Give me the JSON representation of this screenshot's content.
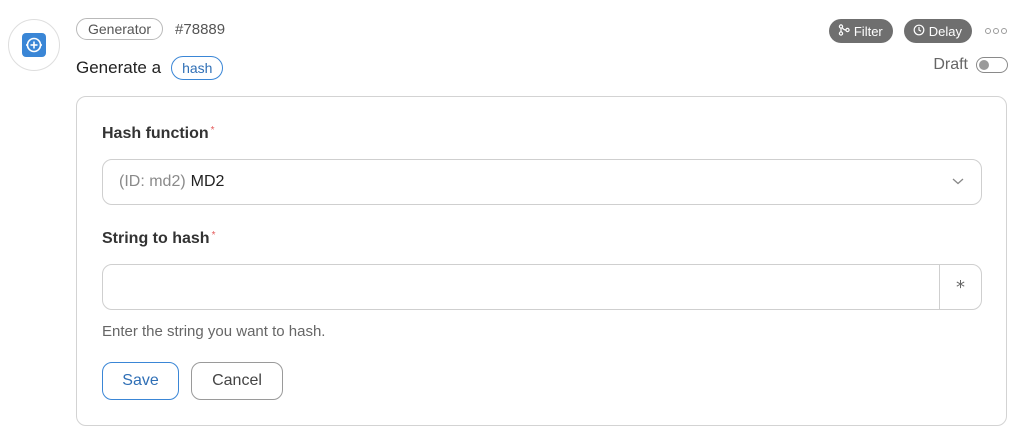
{
  "header": {
    "app_pill": "Generator",
    "step_id": "#78889",
    "title_prefix": "Generate a",
    "action_pill": "hash"
  },
  "controls": {
    "filter_label": "Filter",
    "delay_label": "Delay",
    "draft_label": "Draft",
    "draft_enabled": false
  },
  "form": {
    "hash_function": {
      "label": "Hash function",
      "required_mark": "*",
      "id_prefix": "(ID: md2)",
      "value": "MD2"
    },
    "string_to_hash": {
      "label": "String to hash",
      "required_mark": "*",
      "value": "",
      "special_button": "*",
      "help": "Enter the string you want to hash."
    },
    "save_label": "Save",
    "cancel_label": "Cancel"
  },
  "icons": {
    "app": "generator-icon",
    "filter": "branch-filter-icon",
    "delay": "clock-icon",
    "more": "more-dots-icon",
    "dropdown": "chevron-down-icon"
  },
  "colors": {
    "accent": "#3a86d6",
    "chip_bg": "#6f6f6f",
    "required": "#e45a5a"
  }
}
